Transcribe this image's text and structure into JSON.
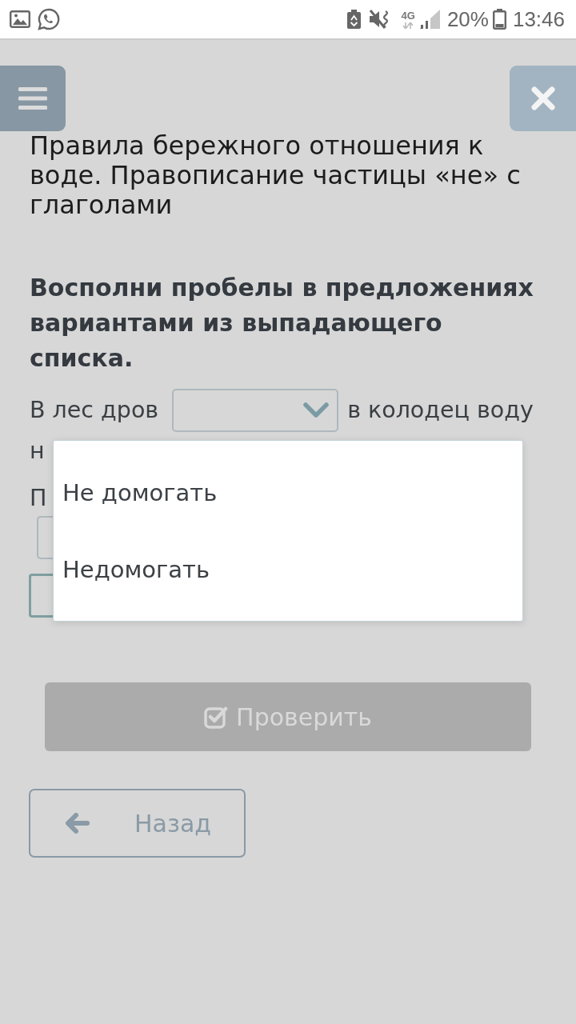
{
  "status_bar": {
    "network": "4G",
    "battery": "20%",
    "time": "13:46"
  },
  "title": "Правила бережного отношения к воде. Правописание частицы «не» с глаголами",
  "instruction": "Восполни пробелы в предложениях вариантами из выпадающего списка.",
  "exercise": {
    "lines": [
      [
        {
          "kind": "text",
          "text": "В лес дров"
        },
        {
          "kind": "select",
          "covered": false
        },
        {
          "kind": "text",
          "text": "в колодец воду"
        }
      ],
      [
        {
          "kind": "text",
          "text": "н"
        }
      ],
      [
        {
          "kind": "text",
          "text": "П"
        }
      ],
      [
        {
          "kind": "select",
          "covered": true
        }
      ],
      [
        {
          "kind": "input",
          "covered": true
        }
      ]
    ]
  },
  "dropdown_menu": {
    "options": [
      {
        "label": "Не домогать",
        "selected": false
      },
      {
        "label": "Недомогать",
        "selected": false
      }
    ]
  },
  "check_button": {
    "label": "Проверить",
    "disabled": true
  },
  "back_button": {
    "label": "Назад"
  }
}
